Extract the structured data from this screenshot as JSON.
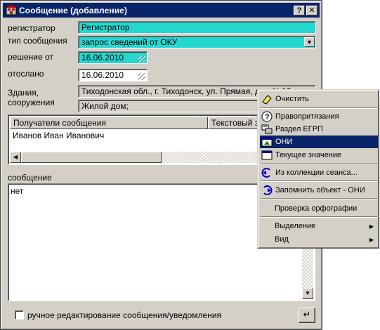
{
  "window": {
    "title": "Сообщение  (добавление)",
    "help_button": "?",
    "close_button": "✕"
  },
  "form": {
    "registrar_label": "регистратор",
    "registrar_value": "Регистратор",
    "message_type_label": "тип сообщения",
    "message_type_value": "запрос сведений от ОКУ",
    "decision_label": "решение от",
    "decision_value": "16.06.2010",
    "sent_label": "отослано",
    "sent_value": "16.06.2010",
    "buildings_label_1": "Здания,",
    "buildings_label_2": "сооружения",
    "address_value": "Тиходонская обл., г. Тиходонск, ул. Прямая, дом №16",
    "building_type_value": "Жилой дом;"
  },
  "recipients_grid": {
    "columns": [
      "Получатели сообщения",
      "Текстовый з"
    ],
    "rows": [
      [
        "Иванов Иван Иванович",
        ""
      ]
    ]
  },
  "message": {
    "label": "сообщение",
    "value": "нет"
  },
  "footer": {
    "manual_edit_label": "ручное редактирование сообщения/уведомления",
    "enter_glyph": "↵"
  },
  "context_menu": {
    "items": [
      {
        "label": "Очистить",
        "icon": "eraser-icon"
      },
      {
        "label": "Правопритязания",
        "icon": "question-icon"
      },
      {
        "label": "Раздел ЕГРП",
        "icon": "register-icon"
      },
      {
        "label": "ОНИ",
        "icon": "object-icon",
        "selected": true
      },
      {
        "label": "Текущее значение",
        "icon": "window-icon"
      },
      {
        "label": "Из коллекции сеанса...",
        "icon": "collection-icon"
      },
      {
        "label": "Запомнить объект - ОНИ",
        "icon": "remember-icon"
      },
      {
        "label": "Проверка орфографии"
      },
      {
        "label": "Выделение",
        "submenu": true
      },
      {
        "label": "Вид",
        "submenu": true
      }
    ],
    "submenu_arrow": "▶"
  },
  "colors": {
    "title_bar": "#0a246a",
    "highlight_field": "#22d8d0",
    "window_face": "#d4d0c8",
    "menu_selection": "#0a246a"
  }
}
